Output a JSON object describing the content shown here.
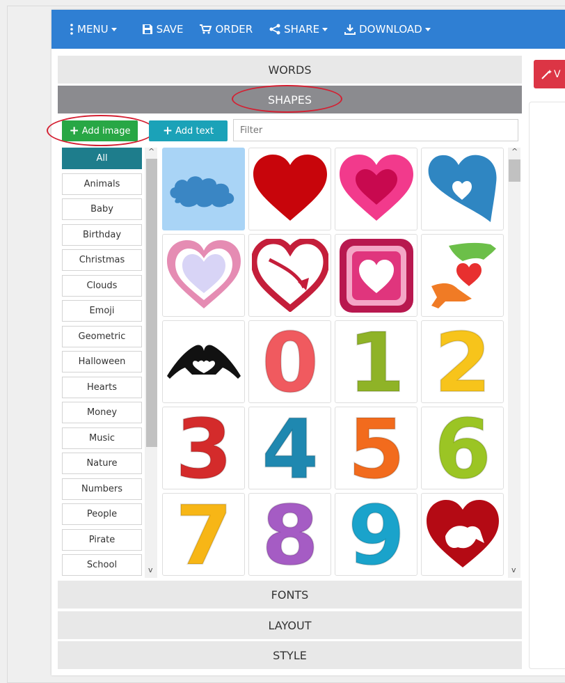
{
  "toolbar": {
    "menu": "MENU",
    "save": "SAVE",
    "order": "ORDER",
    "share": "SHARE",
    "download": "DOWNLOAD"
  },
  "sections": {
    "words": "WORDS",
    "shapes": "SHAPES",
    "fonts": "FONTS",
    "layout": "LAYOUT",
    "style": "STYLE"
  },
  "buttons": {
    "add_image": "Add image",
    "add_text": "Add text",
    "visualize_partial": "V"
  },
  "filter": {
    "placeholder": "Filter"
  },
  "categories": [
    "All",
    "Animals",
    "Baby",
    "Birthday",
    "Christmas",
    "Clouds",
    "Emoji",
    "Geometric",
    "Halloween",
    "Hearts",
    "Money",
    "Music",
    "Nature",
    "Numbers",
    "People",
    "Pirate",
    "School"
  ],
  "selected_category": "All",
  "shapes": [
    {
      "name": "cloud-shape",
      "color": "#3a86c4"
    },
    {
      "name": "red-heart-shape",
      "color": "#c8050b"
    },
    {
      "name": "pink-heart-shape",
      "color": "#f23a8c"
    },
    {
      "name": "blue-heart-shape",
      "color": "#2f86c2"
    },
    {
      "name": "pastel-heart-shape",
      "color": "#e58cb3"
    },
    {
      "name": "arrow-heart-shape",
      "color": "#c41e3a"
    },
    {
      "name": "heart-square-shape",
      "color": "#e0357d"
    },
    {
      "name": "hands-heart-shape",
      "color": "#e8302f"
    },
    {
      "name": "hand-heart-silhouette-shape",
      "color": "#111111"
    },
    {
      "name": "number-0-shape",
      "color": "#f05a5f",
      "label": "0"
    },
    {
      "name": "number-1-shape",
      "color": "#8fb327",
      "label": "1"
    },
    {
      "name": "number-2-shape",
      "color": "#f7c41b",
      "label": "2"
    },
    {
      "name": "number-3-shape",
      "color": "#d42b2b",
      "label": "3"
    },
    {
      "name": "number-4-shape",
      "color": "#1f88b0",
      "label": "4"
    },
    {
      "name": "number-5-shape",
      "color": "#f26b1d",
      "label": "5"
    },
    {
      "name": "number-6-shape",
      "color": "#9bc524",
      "label": "6"
    },
    {
      "name": "number-7-shape",
      "color": "#f7b616",
      "label": "7"
    },
    {
      "name": "number-8-shape",
      "color": "#a55cc4",
      "label": "8"
    },
    {
      "name": "number-9-shape",
      "color": "#1aa3cb",
      "label": "9"
    },
    {
      "name": "cat-dog-heart-shape",
      "color": "#b40a14"
    }
  ]
}
